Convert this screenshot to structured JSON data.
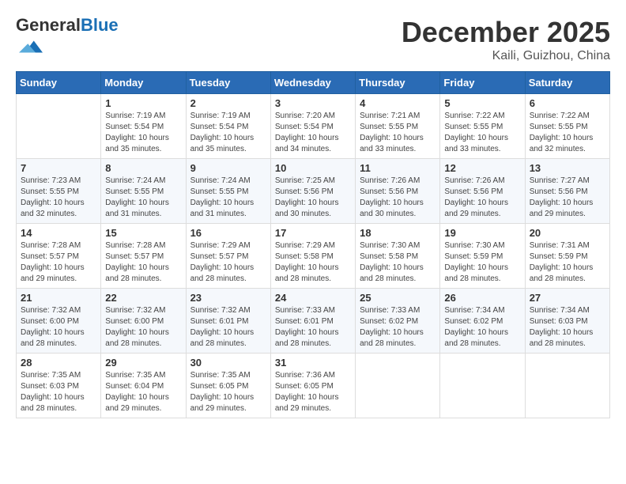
{
  "header": {
    "logo_general": "General",
    "logo_blue": "Blue",
    "month": "December 2025",
    "location": "Kaili, Guizhou, China"
  },
  "weekdays": [
    "Sunday",
    "Monday",
    "Tuesday",
    "Wednesday",
    "Thursday",
    "Friday",
    "Saturday"
  ],
  "weeks": [
    [
      {
        "day": "",
        "sunrise": "",
        "sunset": "",
        "daylight": ""
      },
      {
        "day": "1",
        "sunrise": "Sunrise: 7:19 AM",
        "sunset": "Sunset: 5:54 PM",
        "daylight": "Daylight: 10 hours and 35 minutes."
      },
      {
        "day": "2",
        "sunrise": "Sunrise: 7:19 AM",
        "sunset": "Sunset: 5:54 PM",
        "daylight": "Daylight: 10 hours and 35 minutes."
      },
      {
        "day": "3",
        "sunrise": "Sunrise: 7:20 AM",
        "sunset": "Sunset: 5:54 PM",
        "daylight": "Daylight: 10 hours and 34 minutes."
      },
      {
        "day": "4",
        "sunrise": "Sunrise: 7:21 AM",
        "sunset": "Sunset: 5:55 PM",
        "daylight": "Daylight: 10 hours and 33 minutes."
      },
      {
        "day": "5",
        "sunrise": "Sunrise: 7:22 AM",
        "sunset": "Sunset: 5:55 PM",
        "daylight": "Daylight: 10 hours and 33 minutes."
      },
      {
        "day": "6",
        "sunrise": "Sunrise: 7:22 AM",
        "sunset": "Sunset: 5:55 PM",
        "daylight": "Daylight: 10 hours and 32 minutes."
      }
    ],
    [
      {
        "day": "7",
        "sunrise": "Sunrise: 7:23 AM",
        "sunset": "Sunset: 5:55 PM",
        "daylight": "Daylight: 10 hours and 32 minutes."
      },
      {
        "day": "8",
        "sunrise": "Sunrise: 7:24 AM",
        "sunset": "Sunset: 5:55 PM",
        "daylight": "Daylight: 10 hours and 31 minutes."
      },
      {
        "day": "9",
        "sunrise": "Sunrise: 7:24 AM",
        "sunset": "Sunset: 5:55 PM",
        "daylight": "Daylight: 10 hours and 31 minutes."
      },
      {
        "day": "10",
        "sunrise": "Sunrise: 7:25 AM",
        "sunset": "Sunset: 5:56 PM",
        "daylight": "Daylight: 10 hours and 30 minutes."
      },
      {
        "day": "11",
        "sunrise": "Sunrise: 7:26 AM",
        "sunset": "Sunset: 5:56 PM",
        "daylight": "Daylight: 10 hours and 30 minutes."
      },
      {
        "day": "12",
        "sunrise": "Sunrise: 7:26 AM",
        "sunset": "Sunset: 5:56 PM",
        "daylight": "Daylight: 10 hours and 29 minutes."
      },
      {
        "day": "13",
        "sunrise": "Sunrise: 7:27 AM",
        "sunset": "Sunset: 5:56 PM",
        "daylight": "Daylight: 10 hours and 29 minutes."
      }
    ],
    [
      {
        "day": "14",
        "sunrise": "Sunrise: 7:28 AM",
        "sunset": "Sunset: 5:57 PM",
        "daylight": "Daylight: 10 hours and 29 minutes."
      },
      {
        "day": "15",
        "sunrise": "Sunrise: 7:28 AM",
        "sunset": "Sunset: 5:57 PM",
        "daylight": "Daylight: 10 hours and 28 minutes."
      },
      {
        "day": "16",
        "sunrise": "Sunrise: 7:29 AM",
        "sunset": "Sunset: 5:57 PM",
        "daylight": "Daylight: 10 hours and 28 minutes."
      },
      {
        "day": "17",
        "sunrise": "Sunrise: 7:29 AM",
        "sunset": "Sunset: 5:58 PM",
        "daylight": "Daylight: 10 hours and 28 minutes."
      },
      {
        "day": "18",
        "sunrise": "Sunrise: 7:30 AM",
        "sunset": "Sunset: 5:58 PM",
        "daylight": "Daylight: 10 hours and 28 minutes."
      },
      {
        "day": "19",
        "sunrise": "Sunrise: 7:30 AM",
        "sunset": "Sunset: 5:59 PM",
        "daylight": "Daylight: 10 hours and 28 minutes."
      },
      {
        "day": "20",
        "sunrise": "Sunrise: 7:31 AM",
        "sunset": "Sunset: 5:59 PM",
        "daylight": "Daylight: 10 hours and 28 minutes."
      }
    ],
    [
      {
        "day": "21",
        "sunrise": "Sunrise: 7:32 AM",
        "sunset": "Sunset: 6:00 PM",
        "daylight": "Daylight: 10 hours and 28 minutes."
      },
      {
        "day": "22",
        "sunrise": "Sunrise: 7:32 AM",
        "sunset": "Sunset: 6:00 PM",
        "daylight": "Daylight: 10 hours and 28 minutes."
      },
      {
        "day": "23",
        "sunrise": "Sunrise: 7:32 AM",
        "sunset": "Sunset: 6:01 PM",
        "daylight": "Daylight: 10 hours and 28 minutes."
      },
      {
        "day": "24",
        "sunrise": "Sunrise: 7:33 AM",
        "sunset": "Sunset: 6:01 PM",
        "daylight": "Daylight: 10 hours and 28 minutes."
      },
      {
        "day": "25",
        "sunrise": "Sunrise: 7:33 AM",
        "sunset": "Sunset: 6:02 PM",
        "daylight": "Daylight: 10 hours and 28 minutes."
      },
      {
        "day": "26",
        "sunrise": "Sunrise: 7:34 AM",
        "sunset": "Sunset: 6:02 PM",
        "daylight": "Daylight: 10 hours and 28 minutes."
      },
      {
        "day": "27",
        "sunrise": "Sunrise: 7:34 AM",
        "sunset": "Sunset: 6:03 PM",
        "daylight": "Daylight: 10 hours and 28 minutes."
      }
    ],
    [
      {
        "day": "28",
        "sunrise": "Sunrise: 7:35 AM",
        "sunset": "Sunset: 6:03 PM",
        "daylight": "Daylight: 10 hours and 28 minutes."
      },
      {
        "day": "29",
        "sunrise": "Sunrise: 7:35 AM",
        "sunset": "Sunset: 6:04 PM",
        "daylight": "Daylight: 10 hours and 29 minutes."
      },
      {
        "day": "30",
        "sunrise": "Sunrise: 7:35 AM",
        "sunset": "Sunset: 6:05 PM",
        "daylight": "Daylight: 10 hours and 29 minutes."
      },
      {
        "day": "31",
        "sunrise": "Sunrise: 7:36 AM",
        "sunset": "Sunset: 6:05 PM",
        "daylight": "Daylight: 10 hours and 29 minutes."
      },
      {
        "day": "",
        "sunrise": "",
        "sunset": "",
        "daylight": ""
      },
      {
        "day": "",
        "sunrise": "",
        "sunset": "",
        "daylight": ""
      },
      {
        "day": "",
        "sunrise": "",
        "sunset": "",
        "daylight": ""
      }
    ]
  ]
}
